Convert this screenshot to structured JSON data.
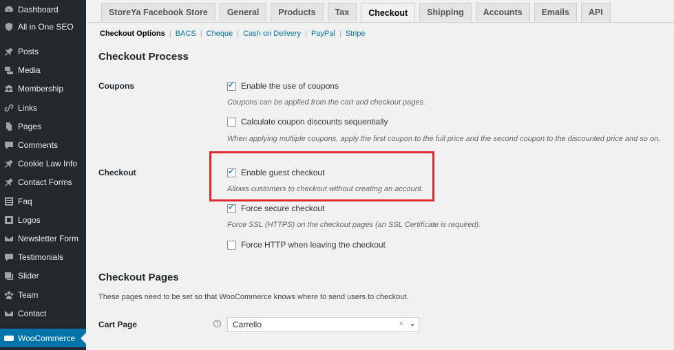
{
  "sidebar": {
    "items": [
      {
        "label": "Dashboard",
        "icon": "dashboard-icon"
      },
      {
        "label": "All in One SEO",
        "icon": "shield-icon"
      },
      {
        "label": "Posts",
        "icon": "pin-icon"
      },
      {
        "label": "Media",
        "icon": "media-icon"
      },
      {
        "label": "Membership",
        "icon": "membership-icon"
      },
      {
        "label": "Links",
        "icon": "link-icon"
      },
      {
        "label": "Pages",
        "icon": "pages-icon"
      },
      {
        "label": "Comments",
        "icon": "comment-icon"
      },
      {
        "label": "Cookie Law Info",
        "icon": "pin-icon"
      },
      {
        "label": "Contact Forms",
        "icon": "pin-icon"
      },
      {
        "label": "Faq",
        "icon": "list-icon"
      },
      {
        "label": "Logos",
        "icon": "logos-icon"
      },
      {
        "label": "Newsletter Form",
        "icon": "mail-icon"
      },
      {
        "label": "Testimonials",
        "icon": "comment-icon"
      },
      {
        "label": "Slider",
        "icon": "slider-icon"
      },
      {
        "label": "Team",
        "icon": "team-icon"
      },
      {
        "label": "Contact",
        "icon": "mail-icon"
      },
      {
        "label": "WooCommerce",
        "icon": "woo-icon",
        "active": true
      }
    ]
  },
  "tabs": [
    "StoreYa Facebook Store",
    "General",
    "Products",
    "Tax",
    "Checkout",
    "Shipping",
    "Accounts",
    "Emails",
    "API"
  ],
  "active_tab": "Checkout",
  "subnav": {
    "current": "Checkout Options",
    "links": [
      "BACS",
      "Cheque",
      "Cash on Delivery",
      "PayPal",
      "Stripe"
    ],
    "separator": "|"
  },
  "checkout_process": {
    "title": "Checkout Process",
    "coupons": {
      "label": "Coupons",
      "enable_coupons": {
        "label": "Enable the use of coupons",
        "checked": true
      },
      "enable_coupons_desc": "Coupons can be applied from the cart and checkout pages.",
      "sequential": {
        "label": "Calculate coupon discounts sequentially",
        "checked": false
      },
      "sequential_desc": "When applying multiple coupons, apply the first coupon to the full price and the second coupon to the discounted price and so on."
    },
    "checkout": {
      "label": "Checkout",
      "guest": {
        "label": "Enable guest checkout",
        "checked": true
      },
      "guest_desc": "Allows customers to checkout without creating an account.",
      "secure": {
        "label": "Force secure checkout",
        "checked": true
      },
      "secure_desc": "Force SSL (HTTPS) on the checkout pages (an SSL Certificate is required).",
      "http": {
        "label": "Force HTTP when leaving the checkout",
        "checked": false
      }
    }
  },
  "checkout_pages": {
    "title": "Checkout Pages",
    "description": "These pages need to be set so that WooCommerce knows where to send users to checkout.",
    "cart_page": {
      "label": "Cart Page",
      "help": "?",
      "value": "Carrello",
      "clear": "×"
    }
  },
  "colors": {
    "sidebar_bg": "#23282d",
    "active_blue": "#0073aa",
    "highlight_red": "#e02a2a"
  }
}
